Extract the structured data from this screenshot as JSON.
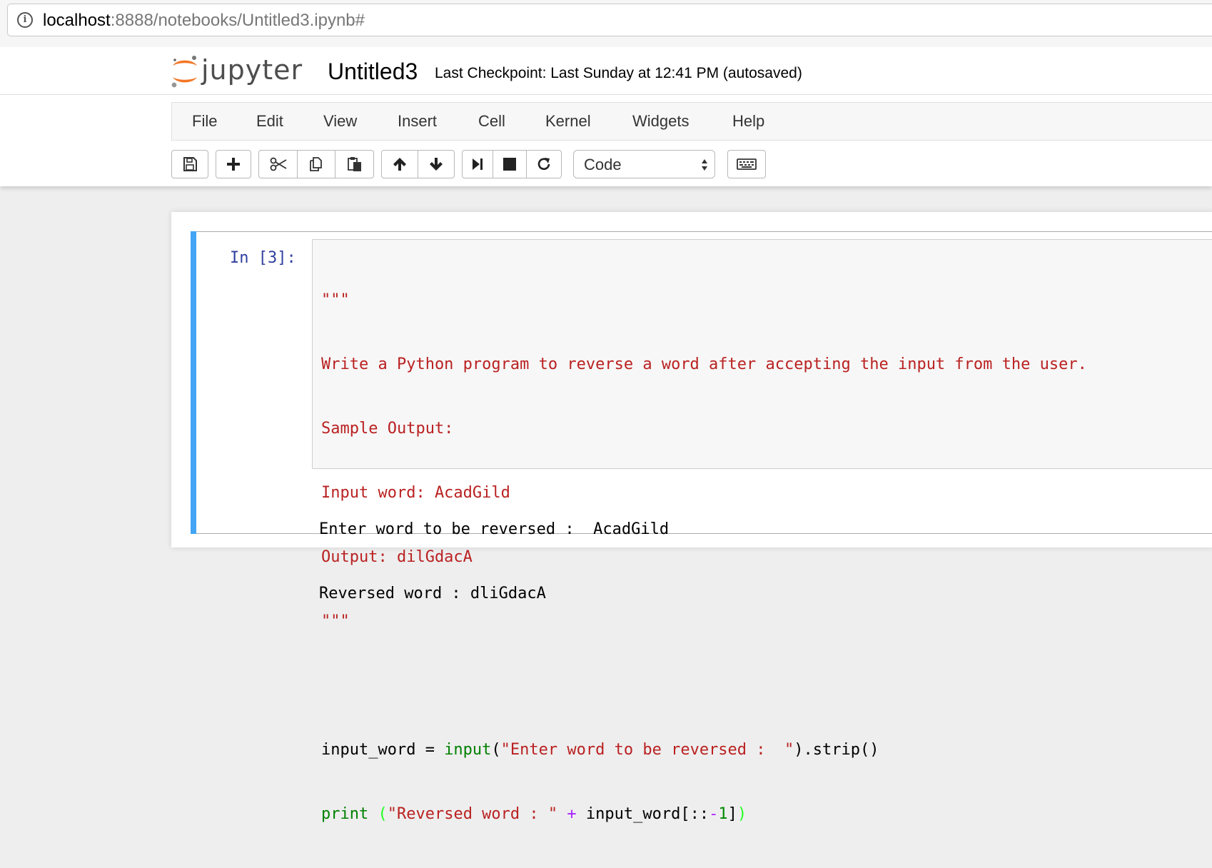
{
  "browser": {
    "url_host": "localhost",
    "url_rest": ":8888/notebooks/Untitled3.ipynb#"
  },
  "header": {
    "logo_text": "jupyter",
    "notebook_name": "Untitled3",
    "checkpoint": "Last Checkpoint: Last Sunday at 12:41 PM (autosaved)"
  },
  "menu": {
    "items": [
      "File",
      "Edit",
      "View",
      "Insert",
      "Cell",
      "Kernel",
      "Widgets",
      "Help"
    ]
  },
  "toolbar": {
    "buttons": [
      {
        "icon": "save-icon"
      },
      {
        "icon": "plus-icon"
      },
      {
        "icon": "scissors-icon"
      },
      {
        "icon": "copy-icon"
      },
      {
        "icon": "paste-icon"
      },
      {
        "icon": "arrow-up-icon"
      },
      {
        "icon": "arrow-down-icon"
      },
      {
        "icon": "step-forward-icon"
      },
      {
        "icon": "stop-icon"
      },
      {
        "icon": "restart-icon"
      },
      {
        "icon": "keyboard-icon"
      }
    ],
    "cell_type": "Code"
  },
  "cell": {
    "prompt": "In [3]:",
    "code_lines": [
      "\"\"\"",
      "Write a Python program to reverse a word after accepting the input from the user.",
      "Sample Output:",
      "Input word: AcadGild",
      "Output: dilGdacA",
      "\"\"\"",
      "",
      "input_word = input(\"Enter word to be reversed :  \").strip()",
      "print (\"Reversed word : \" + input_word[::-1])"
    ],
    "code_tokens": {
      "line8_var": "input_word = ",
      "line8_fn": "input",
      "line8_open": "(",
      "line8_str": "\"Enter word to be reversed :  \"",
      "line8_rest": ").strip()",
      "line9_fn": "print",
      "line9_open": " (",
      "line9_str": "\"Reversed word : \"",
      "line9_plus": "+",
      "line9_var": " input_word[::",
      "line9_minus": "-",
      "line9_num": "1",
      "line9_bracket": "]",
      "line9_close": ")"
    },
    "output_lines": [
      "Enter word to be reversed :  AcadGild",
      "Reversed word : dliGdacA"
    ]
  },
  "colors": {
    "accent": "#42a5f5",
    "prompt": "#303f9f",
    "string": "#ba2121",
    "builtin": "#008000",
    "operator": "#aa22ff"
  }
}
